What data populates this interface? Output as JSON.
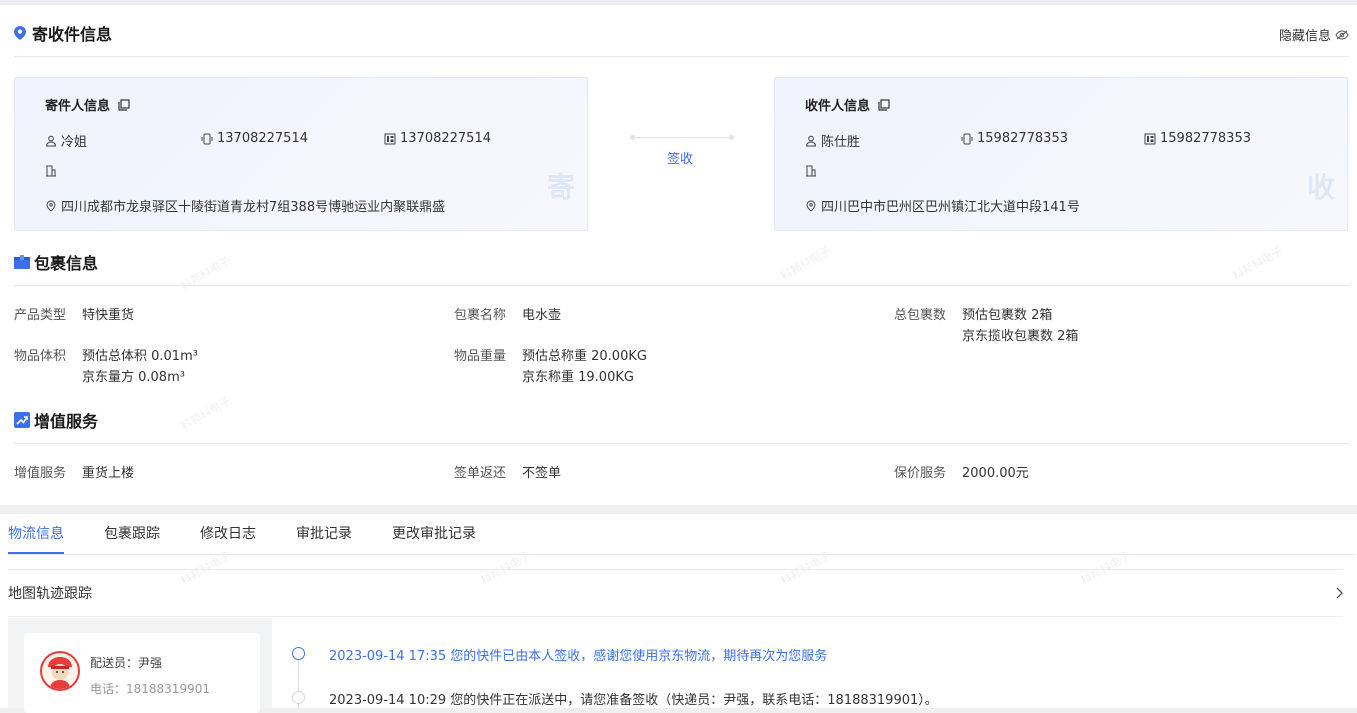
{
  "contact_section": {
    "title": "寄收件信息",
    "hide_label": "隐藏信息",
    "sender": {
      "title": "寄件人信息",
      "name": "冷姐",
      "mobile": "13708227514",
      "phone": "13708227514",
      "address": "四川成都市龙泉驿区十陵街道青龙村7组388号博驰运业内聚联鼎盛",
      "badge": "寄"
    },
    "status": "签收",
    "receiver": {
      "title": "收件人信息",
      "name": "陈仕胜",
      "mobile": "15982778353",
      "phone": "15982778353",
      "address": "四川巴中市巴州区巴州镇江北大道中段141号",
      "badge": "收"
    }
  },
  "package_section": {
    "title": "包裹信息",
    "product_type": {
      "label": "产品类型",
      "value": "特快重货"
    },
    "package_name": {
      "label": "包裹名称",
      "value": "电水壶"
    },
    "package_count": {
      "label": "总包裹数",
      "line1": "预估包裹数 2箱",
      "line2": "京东揽收包裹数 2箱"
    },
    "volume": {
      "label": "物品体积",
      "line1": "预估总体积 0.01m³",
      "line2": "京东量方 0.08m³"
    },
    "weight": {
      "label": "物品重量",
      "line1": "预估总称重 20.00KG",
      "line2": "京东称重 19.00KG"
    }
  },
  "value_added_section": {
    "title": "增值服务",
    "service": {
      "label": "增值服务",
      "value": "重货上楼"
    },
    "return_receipt": {
      "label": "签单返还",
      "value": "不签单"
    },
    "insurance": {
      "label": "保价服务",
      "value": "2000.00元"
    }
  },
  "tabs": [
    "物流信息",
    "包裹跟踪",
    "修改日志",
    "审批记录",
    "更改审批记录"
  ],
  "map_track": {
    "label": "地图轨迹跟踪"
  },
  "courier": {
    "name_label": "配送员：尹强",
    "phone_label": "电话：18188319901"
  },
  "timeline": [
    {
      "text": "2023-09-14 17:35 您的快件已由本人签收，感谢您使用京东物流，期待再次为您服务",
      "active": true
    },
    {
      "text": "2023-09-14 10:29 您的快件正在派送中，请您准备签收（快递员：尹强，联系电话：18188319901）。",
      "active": false
    }
  ],
  "watermark": "科邦科电子",
  "colors": {
    "accent": "#3c6fe8"
  }
}
